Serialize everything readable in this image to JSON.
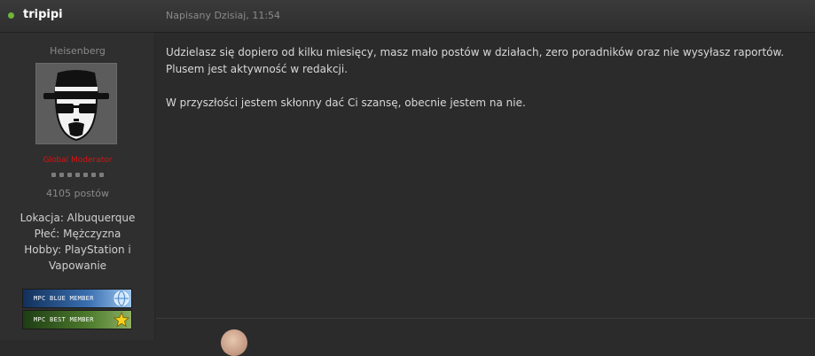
{
  "post": {
    "author": "tripipi",
    "date": "Napisany Dzisiaj, 11:54",
    "online_status": "online"
  },
  "profile": {
    "member_title": "Heisenberg",
    "group": "Global Moderator",
    "rank_pips": 7,
    "post_count": "4105 postów",
    "fields": [
      "Lokacja: Albuquerque",
      "Płeć: Mężczyzna",
      "Hobby: PlayStation i",
      "Vapowanie"
    ],
    "badges": [
      {
        "label": "MPC BLUE MEMBER",
        "icon": "globe-icon"
      },
      {
        "label": "MPC BEST MEMBER",
        "icon": "star-icon"
      }
    ]
  },
  "body": {
    "line1": "Udzielasz się dopiero od kilku miesięcy, masz mało postów w działach, zero poradników oraz nie wysyłasz raportów.",
    "line2": "Plusem jest aktywność w redakcji.",
    "line3": "W przyszłości jestem skłonny dać Ci szansę, obecnie jestem na nie."
  },
  "colors": {
    "background": "#2b2b2b",
    "sidebar": "#2f2f2f",
    "online": "#6fb63a",
    "moderator": "#e01010"
  }
}
